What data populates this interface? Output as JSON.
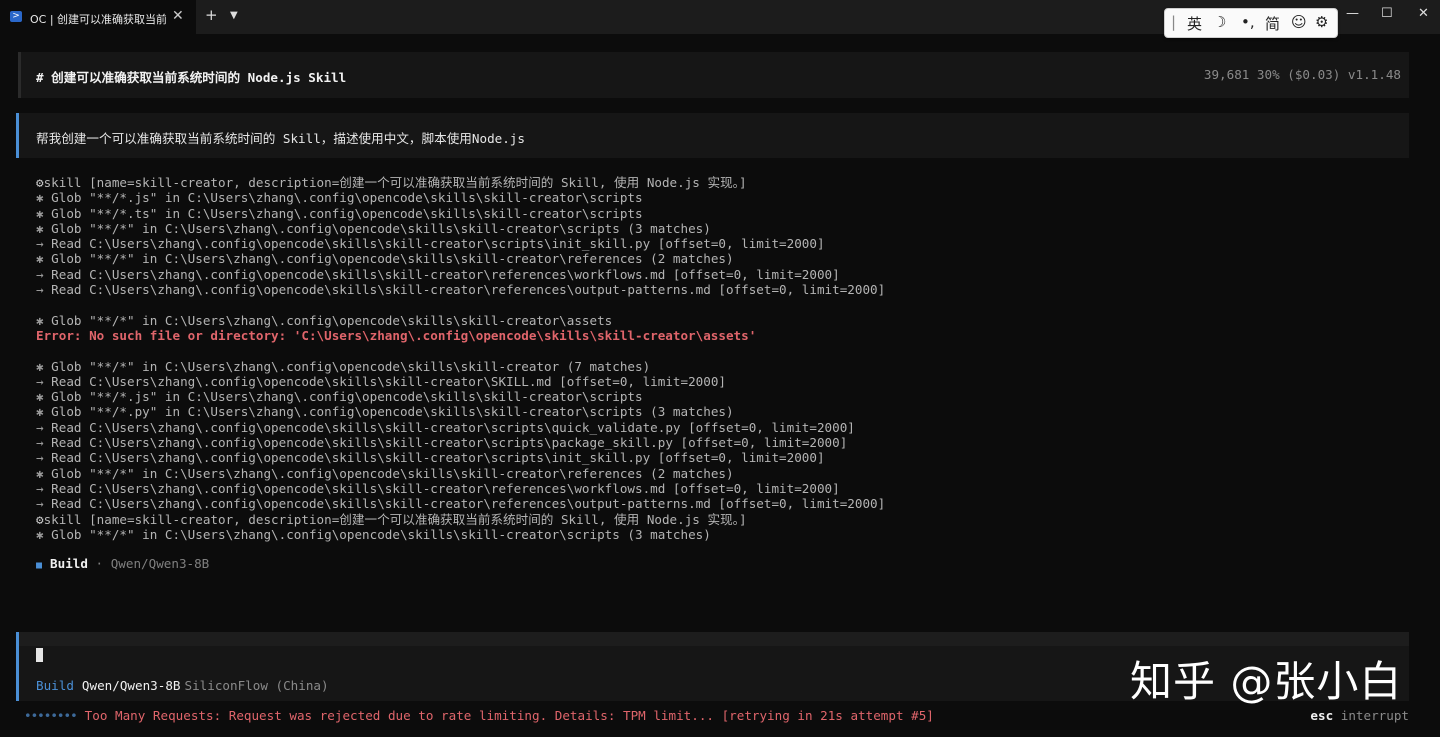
{
  "titlebar": {
    "tab_title": "OC | 创建可以准确获取当前系统",
    "tab_icon": "powershell-icon",
    "new_tab": "+",
    "dropdown": "⌄",
    "minimize": "—",
    "maximize": "☐",
    "close": "✕"
  },
  "ime": {
    "separator": "|",
    "lang": "英",
    "moon": "☽",
    "punct": "•,",
    "charset": "简",
    "emoji": "☺",
    "settings": "⚙"
  },
  "header": {
    "title": "# 创建可以准确获取当前系统时间的 Node.js Skill",
    "stats": "39,681  30% ($0.03) v1.1.48"
  },
  "prompt": {
    "text": "帮我创建一个可以准确获取当前系统时间的 Skill，描述使用中文，脚本使用Node.js"
  },
  "log": [
    {
      "sym": "⚙",
      "text": "skill [name=skill-creator, description=创建一个可以准确获取当前系统时间的 Skill, 使用 Node.js 实现。]"
    },
    {
      "sym": "✱",
      "text": " Glob \"**/*.js\" in C:\\Users\\zhang\\.config\\opencode\\skills\\skill-creator\\scripts"
    },
    {
      "sym": "✱",
      "text": " Glob \"**/*.ts\" in C:\\Users\\zhang\\.config\\opencode\\skills\\skill-creator\\scripts"
    },
    {
      "sym": "✱",
      "text": " Glob \"**/*\" in C:\\Users\\zhang\\.config\\opencode\\skills\\skill-creator\\scripts (3 matches)"
    },
    {
      "sym": "→",
      "text": " Read C:\\Users\\zhang\\.config\\opencode\\skills\\skill-creator\\scripts\\init_skill.py [offset=0, limit=2000]"
    },
    {
      "sym": "✱",
      "text": " Glob \"**/*\" in C:\\Users\\zhang\\.config\\opencode\\skills\\skill-creator\\references (2 matches)"
    },
    {
      "sym": "→",
      "text": " Read C:\\Users\\zhang\\.config\\opencode\\skills\\skill-creator\\references\\workflows.md [offset=0, limit=2000]"
    },
    {
      "sym": "→",
      "text": " Read C:\\Users\\zhang\\.config\\opencode\\skills\\skill-creator\\references\\output-patterns.md [offset=0, limit=2000]"
    },
    {
      "sym": "",
      "text": ""
    },
    {
      "sym": "✱",
      "text": " Glob \"**/*\" in C:\\Users\\zhang\\.config\\opencode\\skills\\skill-creator\\assets"
    },
    {
      "sym": "",
      "text": "Error: No such file or directory: 'C:\\Users\\zhang\\.config\\opencode\\skills\\skill-creator\\assets'",
      "err": true
    },
    {
      "sym": "",
      "text": ""
    },
    {
      "sym": "✱",
      "text": " Glob \"**/*\" in C:\\Users\\zhang\\.config\\opencode\\skills\\skill-creator (7 matches)"
    },
    {
      "sym": "→",
      "text": " Read C:\\Users\\zhang\\.config\\opencode\\skills\\skill-creator\\SKILL.md [offset=0, limit=2000]"
    },
    {
      "sym": "✱",
      "text": " Glob \"**/*.js\" in C:\\Users\\zhang\\.config\\opencode\\skills\\skill-creator\\scripts"
    },
    {
      "sym": "✱",
      "text": " Glob \"**/*.py\" in C:\\Users\\zhang\\.config\\opencode\\skills\\skill-creator\\scripts (3 matches)"
    },
    {
      "sym": "→",
      "text": " Read C:\\Users\\zhang\\.config\\opencode\\skills\\skill-creator\\scripts\\quick_validate.py [offset=0, limit=2000]"
    },
    {
      "sym": "→",
      "text": " Read C:\\Users\\zhang\\.config\\opencode\\skills\\skill-creator\\scripts\\package_skill.py [offset=0, limit=2000]"
    },
    {
      "sym": "→",
      "text": " Read C:\\Users\\zhang\\.config\\opencode\\skills\\skill-creator\\scripts\\init_skill.py [offset=0, limit=2000]"
    },
    {
      "sym": "✱",
      "text": " Glob \"**/*\" in C:\\Users\\zhang\\.config\\opencode\\skills\\skill-creator\\references (2 matches)"
    },
    {
      "sym": "→",
      "text": " Read C:\\Users\\zhang\\.config\\opencode\\skills\\skill-creator\\references\\workflows.md [offset=0, limit=2000]"
    },
    {
      "sym": "→",
      "text": " Read C:\\Users\\zhang\\.config\\opencode\\skills\\skill-creator\\references\\output-patterns.md [offset=0, limit=2000]"
    },
    {
      "sym": "⚙",
      "text": "skill [name=skill-creator, description=创建一个可以准确获取当前系统时间的 Skill, 使用 Node.js 实现。]"
    },
    {
      "sym": "✱",
      "text": " Glob \"**/*\" in C:\\Users\\zhang\\.config\\opencode\\skills\\skill-creator\\scripts (3 matches)"
    }
  ],
  "build_status": {
    "icon": "■",
    "agent": "Build",
    "sep_model": " · Qwen/Qwen3-8B"
  },
  "input": {
    "mode": "Build",
    "model": "Qwen/Qwen3-8B",
    "provider": "SiliconFlow (China)"
  },
  "watermark": "知乎 @张小白",
  "status": {
    "spinner": "••••••••",
    "message": "Too Many Requests: Request was rejected due to rate limiting. Details: TPM limit... [retrying in 21s attempt #5]",
    "key": "esc",
    "action": "interrupt"
  },
  "colors": {
    "accent": "#4a8fd6",
    "error": "#e0656b",
    "background": "#0c0c0c",
    "panel": "#161616"
  }
}
